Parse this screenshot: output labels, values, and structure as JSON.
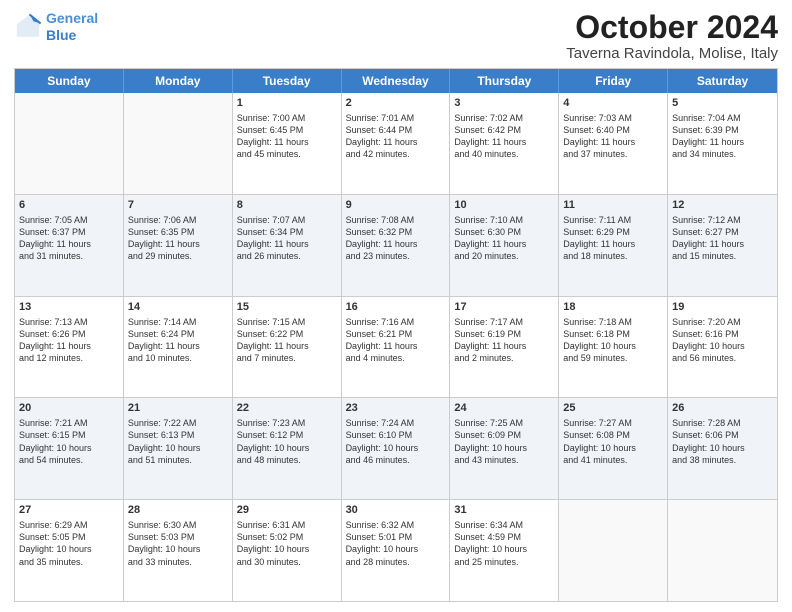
{
  "logo": {
    "line1": "General",
    "line2": "Blue"
  },
  "title": "October 2024",
  "subtitle": "Taverna Ravindola, Molise, Italy",
  "days": [
    "Sunday",
    "Monday",
    "Tuesday",
    "Wednesday",
    "Thursday",
    "Friday",
    "Saturday"
  ],
  "weeks": [
    [
      {
        "day": "",
        "text": ""
      },
      {
        "day": "",
        "text": ""
      },
      {
        "day": "1",
        "text": "Sunrise: 7:00 AM\nSunset: 6:45 PM\nDaylight: 11 hours\nand 45 minutes."
      },
      {
        "day": "2",
        "text": "Sunrise: 7:01 AM\nSunset: 6:44 PM\nDaylight: 11 hours\nand 42 minutes."
      },
      {
        "day": "3",
        "text": "Sunrise: 7:02 AM\nSunset: 6:42 PM\nDaylight: 11 hours\nand 40 minutes."
      },
      {
        "day": "4",
        "text": "Sunrise: 7:03 AM\nSunset: 6:40 PM\nDaylight: 11 hours\nand 37 minutes."
      },
      {
        "day": "5",
        "text": "Sunrise: 7:04 AM\nSunset: 6:39 PM\nDaylight: 11 hours\nand 34 minutes."
      }
    ],
    [
      {
        "day": "6",
        "text": "Sunrise: 7:05 AM\nSunset: 6:37 PM\nDaylight: 11 hours\nand 31 minutes."
      },
      {
        "day": "7",
        "text": "Sunrise: 7:06 AM\nSunset: 6:35 PM\nDaylight: 11 hours\nand 29 minutes."
      },
      {
        "day": "8",
        "text": "Sunrise: 7:07 AM\nSunset: 6:34 PM\nDaylight: 11 hours\nand 26 minutes."
      },
      {
        "day": "9",
        "text": "Sunrise: 7:08 AM\nSunset: 6:32 PM\nDaylight: 11 hours\nand 23 minutes."
      },
      {
        "day": "10",
        "text": "Sunrise: 7:10 AM\nSunset: 6:30 PM\nDaylight: 11 hours\nand 20 minutes."
      },
      {
        "day": "11",
        "text": "Sunrise: 7:11 AM\nSunset: 6:29 PM\nDaylight: 11 hours\nand 18 minutes."
      },
      {
        "day": "12",
        "text": "Sunrise: 7:12 AM\nSunset: 6:27 PM\nDaylight: 11 hours\nand 15 minutes."
      }
    ],
    [
      {
        "day": "13",
        "text": "Sunrise: 7:13 AM\nSunset: 6:26 PM\nDaylight: 11 hours\nand 12 minutes."
      },
      {
        "day": "14",
        "text": "Sunrise: 7:14 AM\nSunset: 6:24 PM\nDaylight: 11 hours\nand 10 minutes."
      },
      {
        "day": "15",
        "text": "Sunrise: 7:15 AM\nSunset: 6:22 PM\nDaylight: 11 hours\nand 7 minutes."
      },
      {
        "day": "16",
        "text": "Sunrise: 7:16 AM\nSunset: 6:21 PM\nDaylight: 11 hours\nand 4 minutes."
      },
      {
        "day": "17",
        "text": "Sunrise: 7:17 AM\nSunset: 6:19 PM\nDaylight: 11 hours\nand 2 minutes."
      },
      {
        "day": "18",
        "text": "Sunrise: 7:18 AM\nSunset: 6:18 PM\nDaylight: 10 hours\nand 59 minutes."
      },
      {
        "day": "19",
        "text": "Sunrise: 7:20 AM\nSunset: 6:16 PM\nDaylight: 10 hours\nand 56 minutes."
      }
    ],
    [
      {
        "day": "20",
        "text": "Sunrise: 7:21 AM\nSunset: 6:15 PM\nDaylight: 10 hours\nand 54 minutes."
      },
      {
        "day": "21",
        "text": "Sunrise: 7:22 AM\nSunset: 6:13 PM\nDaylight: 10 hours\nand 51 minutes."
      },
      {
        "day": "22",
        "text": "Sunrise: 7:23 AM\nSunset: 6:12 PM\nDaylight: 10 hours\nand 48 minutes."
      },
      {
        "day": "23",
        "text": "Sunrise: 7:24 AM\nSunset: 6:10 PM\nDaylight: 10 hours\nand 46 minutes."
      },
      {
        "day": "24",
        "text": "Sunrise: 7:25 AM\nSunset: 6:09 PM\nDaylight: 10 hours\nand 43 minutes."
      },
      {
        "day": "25",
        "text": "Sunrise: 7:27 AM\nSunset: 6:08 PM\nDaylight: 10 hours\nand 41 minutes."
      },
      {
        "day": "26",
        "text": "Sunrise: 7:28 AM\nSunset: 6:06 PM\nDaylight: 10 hours\nand 38 minutes."
      }
    ],
    [
      {
        "day": "27",
        "text": "Sunrise: 6:29 AM\nSunset: 5:05 PM\nDaylight: 10 hours\nand 35 minutes."
      },
      {
        "day": "28",
        "text": "Sunrise: 6:30 AM\nSunset: 5:03 PM\nDaylight: 10 hours\nand 33 minutes."
      },
      {
        "day": "29",
        "text": "Sunrise: 6:31 AM\nSunset: 5:02 PM\nDaylight: 10 hours\nand 30 minutes."
      },
      {
        "day": "30",
        "text": "Sunrise: 6:32 AM\nSunset: 5:01 PM\nDaylight: 10 hours\nand 28 minutes."
      },
      {
        "day": "31",
        "text": "Sunrise: 6:34 AM\nSunset: 4:59 PM\nDaylight: 10 hours\nand 25 minutes."
      },
      {
        "day": "",
        "text": ""
      },
      {
        "day": "",
        "text": ""
      }
    ]
  ]
}
